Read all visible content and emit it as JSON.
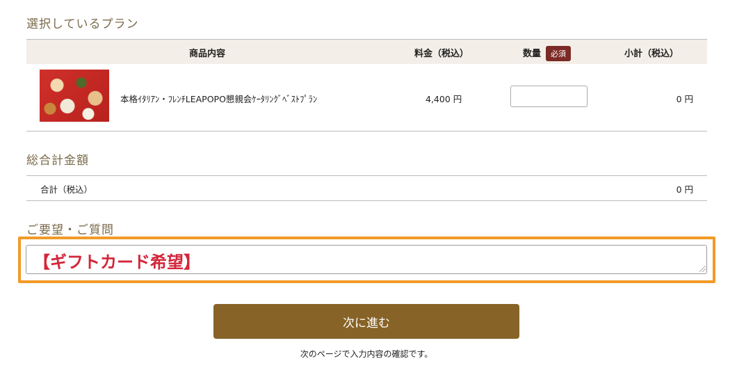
{
  "sections": {
    "plan_title": "選択しているプラン",
    "total_title": "総合計金額",
    "request_title": "ご要望・ご質問"
  },
  "plan_table": {
    "headers": {
      "item": "商品内容",
      "price": "料金（税込）",
      "quantity": "数量",
      "required_badge": "必須",
      "subtotal": "小計（税込）"
    },
    "row": {
      "name": "本格ｲﾀﾘｱﾝ・ﾌﾚﾝﾁLEAPOPO懇親会ｹｰﾀﾘﾝｸﾞﾍﾞｽﾄﾌﾟﾗﾝ",
      "price": "4,400 円",
      "quantity_value": "",
      "subtotal": "0 円"
    }
  },
  "total": {
    "label": "合計（税込）",
    "value": "0 円"
  },
  "request": {
    "value": "【ギフトカード希望】"
  },
  "actions": {
    "next_label": "次に進む",
    "note": "次のページで入力内容の確認です。"
  },
  "colors": {
    "accent_button": "#876327",
    "required_badge": "#7b2a26",
    "highlight_border": "#f29a27",
    "request_text": "#d3263a",
    "section_title": "#7a6a4a"
  }
}
